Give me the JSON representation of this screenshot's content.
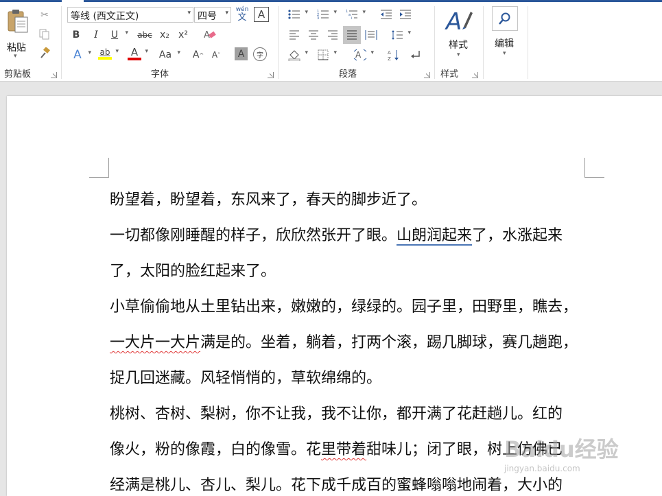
{
  "ribbon": {
    "clipboard": {
      "paste_label": "粘贴",
      "group_label": "剪贴板"
    },
    "font": {
      "font_name": "等线 (西文正文)",
      "font_size": "四号",
      "phonetic_top": "wén",
      "phonetic_bottom": "文",
      "char_border": "A",
      "bold": "B",
      "italic": "I",
      "underline": "U",
      "strike": "abc",
      "subscript": "x₂",
      "superscript": "x²",
      "text_effect": "A",
      "highlight": "ab",
      "font_color": "A",
      "change_case": "Aa",
      "grow_font": "A",
      "shrink_font": "A",
      "char_shading": "A",
      "enclose": "字",
      "group_label": "字体"
    },
    "paragraph": {
      "group_label": "段落"
    },
    "styles": {
      "styles_label": "样式",
      "group_label": "样式"
    },
    "editing": {
      "label": "编辑"
    }
  },
  "document": {
    "lines": [
      {
        "parts": [
          {
            "text": "盼望着，盼望着，东风来了，春天的脚步近了。"
          }
        ]
      },
      {
        "parts": [
          {
            "text": "一切都像刚睡醒的样子，欣欣然张开了眼。"
          },
          {
            "text": "山朗润起来",
            "style": "ul-blue"
          },
          {
            "text": "了，水涨起来"
          }
        ]
      },
      {
        "parts": [
          {
            "text": "了，太阳的脸红起来了。"
          }
        ]
      },
      {
        "parts": [
          {
            "text": "小草偷偷地从土里钻出来，嫩嫩的，绿绿的。园子里，田野里，瞧去，"
          }
        ]
      },
      {
        "parts": [
          {
            "text": "一大片一大片",
            "style": "ul-wavy"
          },
          {
            "text": "满是的。坐着，躺着，打两个滚，踢几脚球，赛几趟跑，"
          }
        ]
      },
      {
        "parts": [
          {
            "text": "捉几回迷藏。风轻悄悄的，草软绵绵的。"
          }
        ]
      },
      {
        "parts": [
          {
            "text": "桃树、杏树、梨树，你不让我，我不让你，都开满了花赶趟儿。红的"
          }
        ]
      },
      {
        "parts": [
          {
            "text": "像火，粉的像霞，白的像雪。花"
          },
          {
            "text": "里带着",
            "style": "ul-wavy"
          },
          {
            "text": "甜味儿；闭了眼，树上仿佛已"
          }
        ]
      },
      {
        "parts": [
          {
            "text": "经满是桃儿、杏儿、梨儿。花下成千成百的蜜蜂嗡嗡地闹着，大小的"
          }
        ]
      }
    ]
  },
  "watermark": {
    "text": "Baidu经验",
    "sub": "jingyan.baidu.com"
  },
  "colors": {
    "accent": "#2b579a",
    "highlight": "#ffff00",
    "font_color": "#e00000"
  }
}
